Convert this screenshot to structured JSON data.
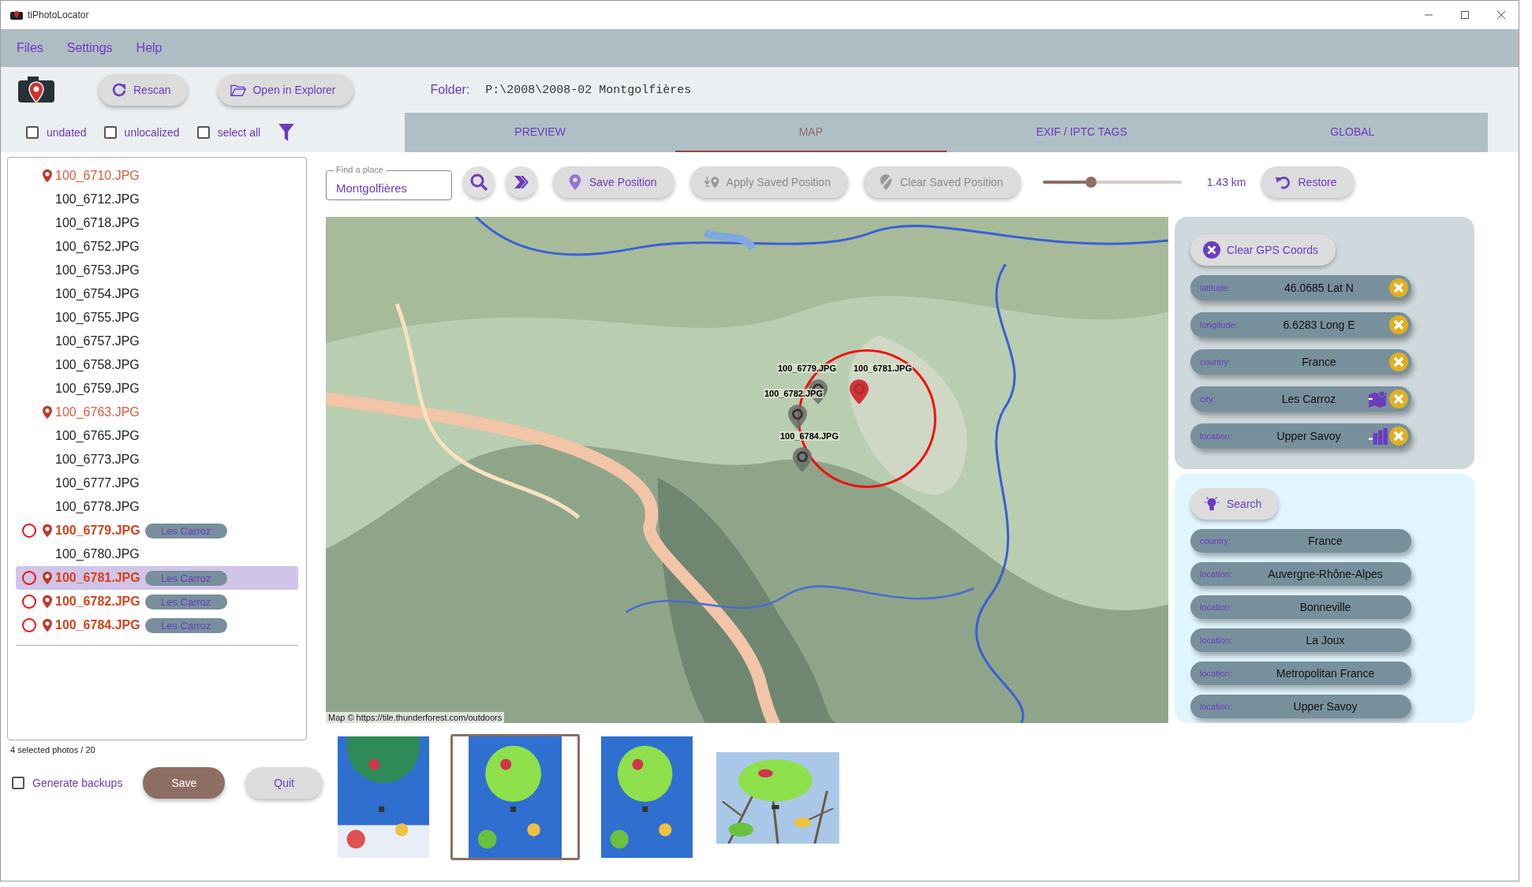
{
  "window": {
    "title": "tiPhotoLocator"
  },
  "menu": [
    "Files",
    "Settings",
    "Help"
  ],
  "toolbar": {
    "buttons": [
      "Rescan",
      "Open in Explorer"
    ],
    "folder_label": "Folder:",
    "folder_path": "P:\\2008\\2008-02 Montgolfières"
  },
  "filters": [
    {
      "label": "undated",
      "checked": false
    },
    {
      "label": "unlocalized",
      "checked": false
    },
    {
      "label": "select all",
      "checked": false
    }
  ],
  "tabs": [
    {
      "label": "PREVIEW",
      "selected": false
    },
    {
      "label": "MAP",
      "selected": true
    },
    {
      "label": "EXIF / IPTC TAGS",
      "selected": false
    },
    {
      "label": "GLOBAL",
      "selected": false
    }
  ],
  "files": [
    {
      "name": "100_6710.JPG",
      "located": true,
      "marked": false,
      "selected": false
    },
    {
      "name": "100_6712.JPG",
      "located": false,
      "marked": false,
      "selected": false
    },
    {
      "name": "100_6718.JPG",
      "located": false,
      "marked": false,
      "selected": false
    },
    {
      "name": "100_6752.JPG",
      "located": false,
      "marked": false,
      "selected": false
    },
    {
      "name": "100_6753.JPG",
      "located": false,
      "marked": false,
      "selected": false
    },
    {
      "name": "100_6754.JPG",
      "located": false,
      "marked": false,
      "selected": false
    },
    {
      "name": "100_6755.JPG",
      "located": false,
      "marked": false,
      "selected": false
    },
    {
      "name": "100_6757.JPG",
      "located": false,
      "marked": false,
      "selected": false
    },
    {
      "name": "100_6758.JPG",
      "located": false,
      "marked": false,
      "selected": false
    },
    {
      "name": "100_6759.JPG",
      "located": false,
      "marked": false,
      "selected": false
    },
    {
      "name": "100_6763.JPG",
      "located": true,
      "marked": false,
      "selected": false
    },
    {
      "name": "100_6765.JPG",
      "located": false,
      "marked": false,
      "selected": false
    },
    {
      "name": "100_6773.JPG",
      "located": false,
      "marked": false,
      "selected": false
    },
    {
      "name": "100_6777.JPG",
      "located": false,
      "marked": false,
      "selected": false
    },
    {
      "name": "100_6778.JPG",
      "located": false,
      "marked": false,
      "selected": false
    },
    {
      "name": "100_6779.JPG",
      "located": true,
      "marked": true,
      "selected": false,
      "tag": "Les Carroz"
    },
    {
      "name": "100_6780.JPG",
      "located": false,
      "marked": false,
      "selected": false
    },
    {
      "name": "100_6781.JPG",
      "located": true,
      "marked": true,
      "selected": true,
      "tag": "Les Carroz"
    },
    {
      "name": "100_6782.JPG",
      "located": true,
      "marked": true,
      "selected": false,
      "tag": "Les Carroz"
    },
    {
      "name": "100_6784.JPG",
      "located": true,
      "marked": true,
      "selected": false,
      "tag": "Les Carroz"
    }
  ],
  "status": "4 selected photos / 20",
  "generate_backups": {
    "label": "Generate backups",
    "checked": false
  },
  "actions": [
    {
      "label": "Save",
      "kind": "primary"
    },
    {
      "label": "Quit",
      "kind": "secondary"
    }
  ],
  "map_toolbar": {
    "search": {
      "label": "Find a place",
      "value": "Montgolfières"
    },
    "buttons": [
      {
        "label": "Save Position",
        "disabled": false,
        "kind": "save"
      },
      {
        "label": "Apply Saved Position",
        "disabled": true,
        "kind": "apply"
      },
      {
        "label": "Clear Saved Position",
        "disabled": true,
        "kind": "clear"
      }
    ],
    "zoom": {
      "level": 0.35,
      "reading": "1.43 km"
    },
    "restore": "Restore"
  },
  "map": {
    "kind": "picture",
    "attribution": "Map © https://tile.thunderforest.com/outdoors",
    "markers": [
      {
        "label": "100_6779.JPG",
        "selected": false
      },
      {
        "label": "100_6781.JPG",
        "selected": true
      },
      {
        "label": "100_6782.JPG",
        "selected": false
      },
      {
        "label": "100_6784.JPG",
        "selected": false
      }
    ]
  },
  "gps": {
    "clear_button": "Clear GPS Coords",
    "fields": [
      {
        "label": "latitude:",
        "value": "46.0685 Lat N",
        "kind": "plain"
      },
      {
        "label": "longitude:",
        "value": "6.6283 Long E",
        "kind": "plain"
      },
      {
        "label": "country:",
        "value": "France",
        "kind": "plain"
      },
      {
        "label": "city:",
        "value": "Les Carroz",
        "kind": "city"
      },
      {
        "label": "location:",
        "value": "Upper Savoy",
        "kind": "location"
      }
    ]
  },
  "suggestions": {
    "search_button": "Search",
    "items": [
      {
        "label": "country:",
        "value": "France"
      },
      {
        "label": "location:",
        "value": "Auvergne-Rhône-Alpes"
      },
      {
        "label": "location:",
        "value": "Bonneville"
      },
      {
        "label": "location:",
        "value": "La Joux"
      },
      {
        "label": "location:",
        "value": "Metropolitan France"
      },
      {
        "label": "location:",
        "value": "Upper Savoy"
      }
    ]
  },
  "thumbnails": [
    {
      "kind": "picture",
      "selected": false
    },
    {
      "kind": "picture",
      "selected": true
    },
    {
      "kind": "picture",
      "selected": false
    },
    {
      "kind": "picture",
      "selected": false
    }
  ]
}
